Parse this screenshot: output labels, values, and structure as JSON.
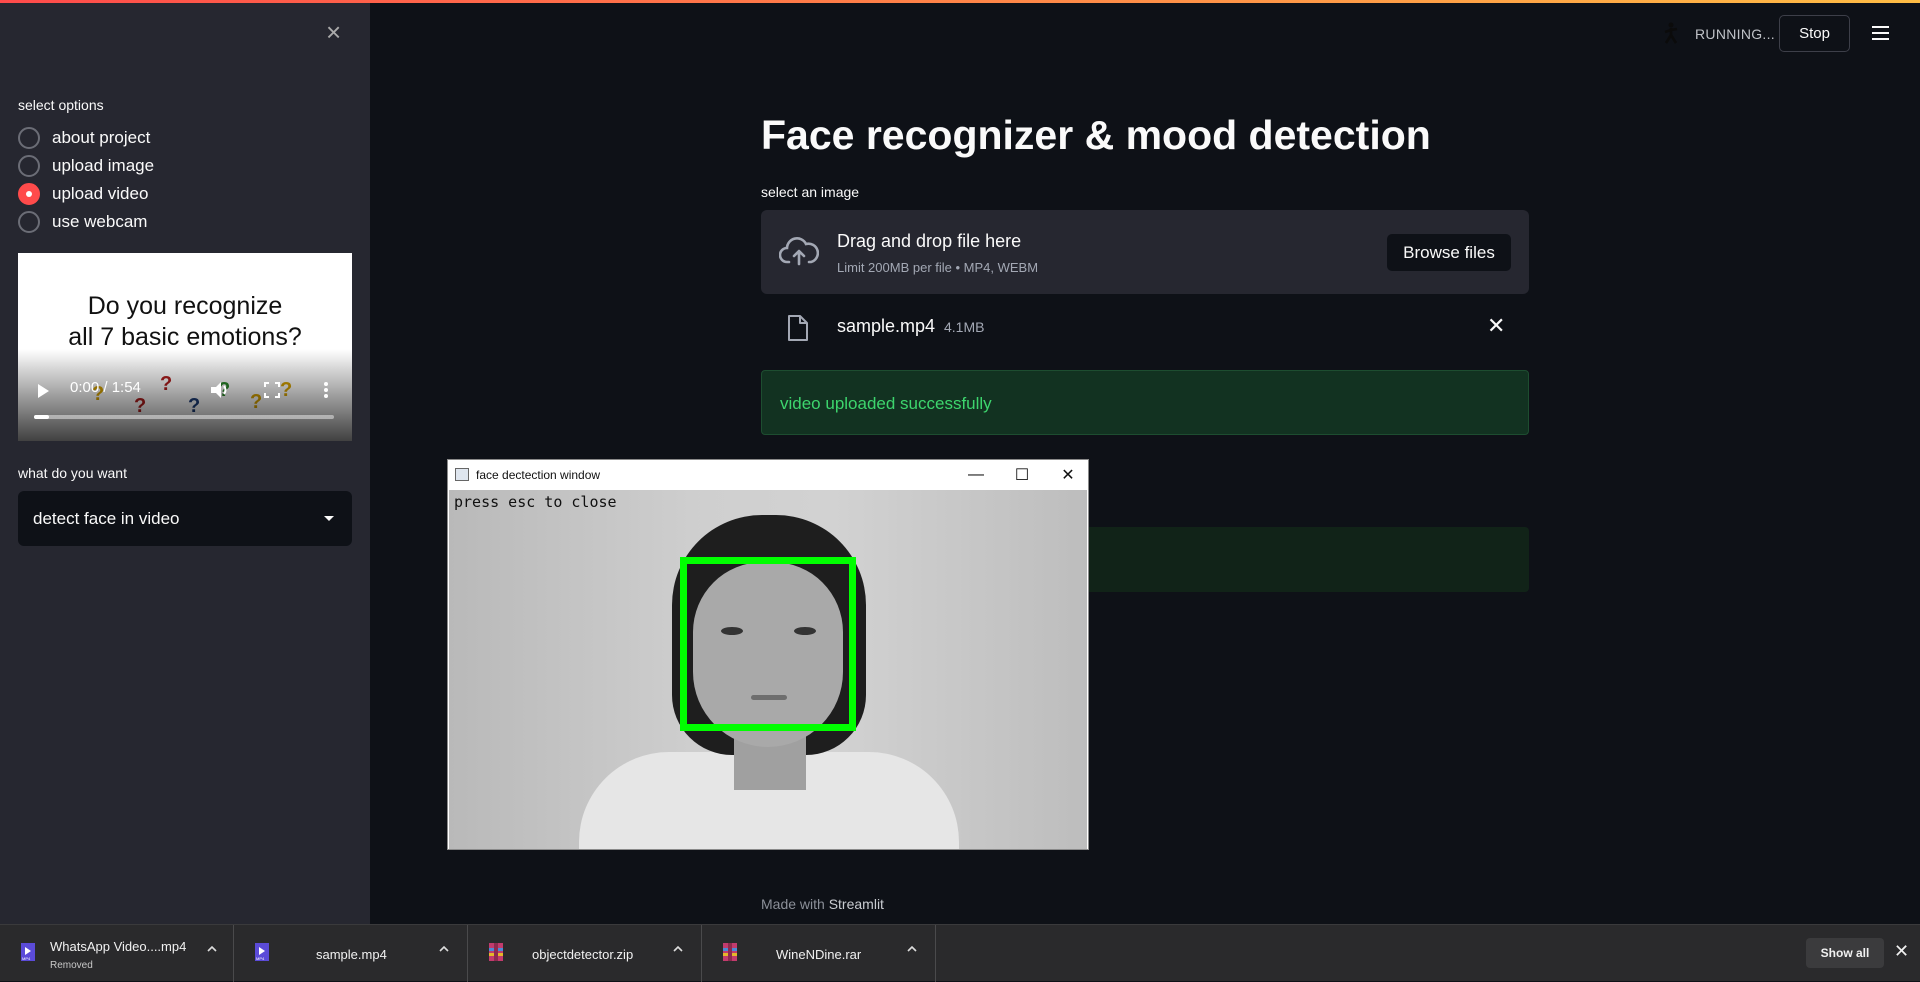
{
  "sidebar": {
    "close_glyph": "×",
    "options_label": "select options",
    "options": [
      {
        "label": "about project",
        "selected": false
      },
      {
        "label": "upload image",
        "selected": false
      },
      {
        "label": "upload video",
        "selected": true
      },
      {
        "label": "use webcam",
        "selected": false
      }
    ],
    "video": {
      "title_line1": "Do you recognize",
      "title_line2": "all 7 basic emotions?",
      "time": "0:00 / 1:54",
      "progress": 0.05
    },
    "want_label": "what do you want",
    "want_value": "detect face in video"
  },
  "header": {
    "status": "RUNNING...",
    "stop_label": "Stop"
  },
  "main": {
    "title": "Face recognizer & mood detection",
    "uploader_label": "select an image",
    "dropzone_title": "Drag and drop file here",
    "dropzone_limit": "Limit 200MB per file • MP4, WEBM",
    "browse_label": "Browse files",
    "file_name": "sample.mp4",
    "file_size": "4.1MB",
    "success_message": "video uploaded successfully",
    "footer_prefix": "Made with",
    "footer_brand": "Streamlit"
  },
  "cv_window": {
    "title": "face dectection window",
    "overlay_text": "press esc to close",
    "minimize_glyph": "—",
    "maximize_glyph": "☐",
    "close_glyph": "✕"
  },
  "downloads": {
    "items": [
      {
        "name": "WhatsApp Video....mp4",
        "sub": "Removed"
      },
      {
        "name": "sample.mp4",
        "sub": ""
      },
      {
        "name": "objectdetector.zip",
        "sub": ""
      },
      {
        "name": "WineNDine.rar",
        "sub": ""
      }
    ],
    "show_all": "Show all",
    "close_glyph": "✕"
  },
  "colors": {
    "accent": "#ff4b4b",
    "success": "#3dd56d",
    "detect_box": "#00ff00",
    "background": "#0e1117",
    "sidebar": "#262730"
  }
}
